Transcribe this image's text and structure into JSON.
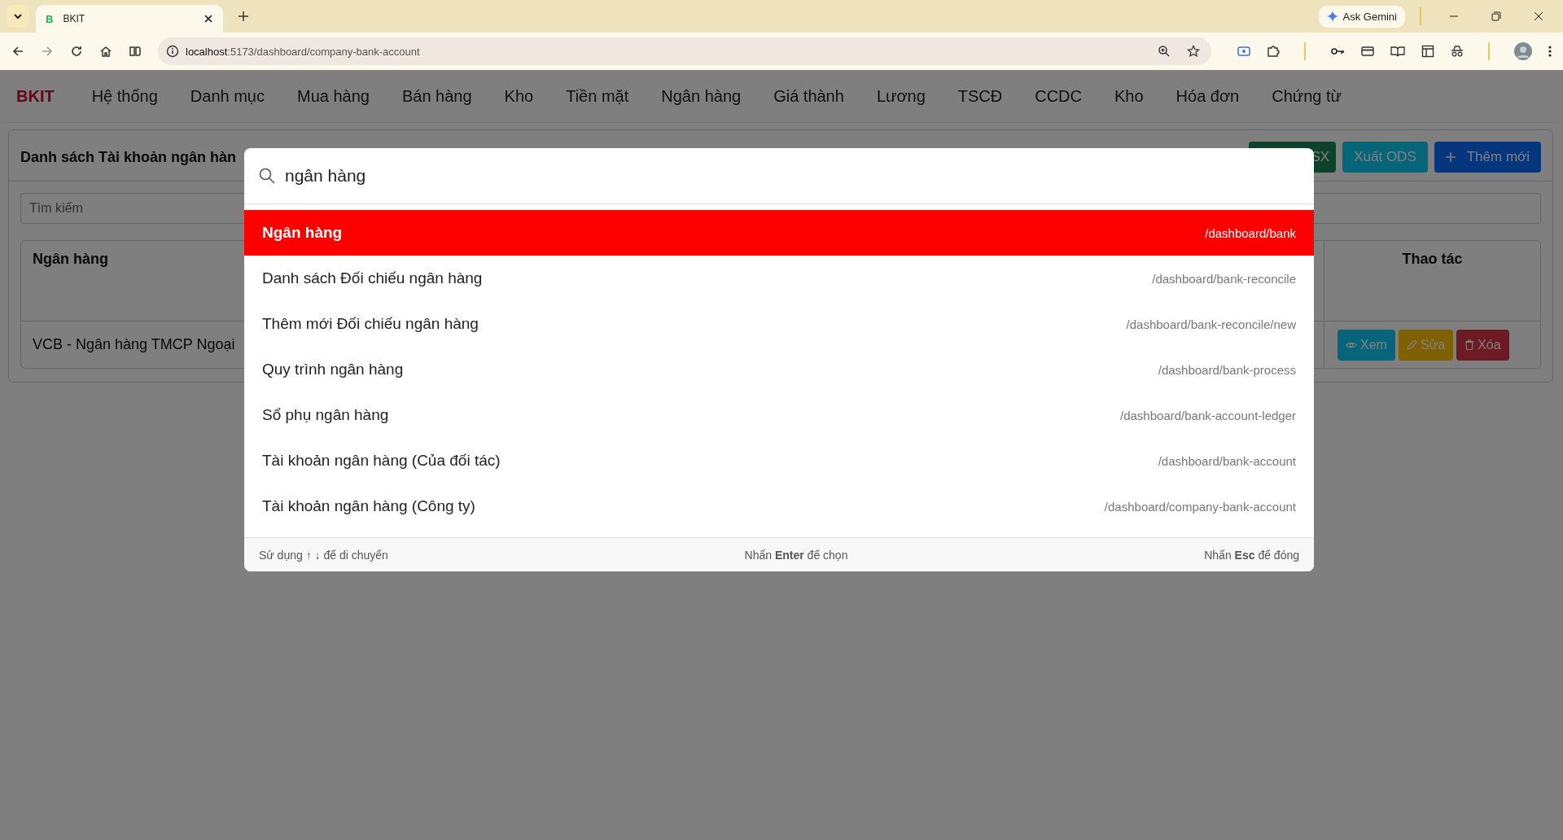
{
  "browser": {
    "tab_title": "BKIT",
    "tab_favicon": "B",
    "url_host": "localhost",
    "url_path": ":5173/dashboard/company-bank-account",
    "gemini_label": "Ask Gemini"
  },
  "nav": {
    "brand": "BKIT",
    "items": [
      "Hệ thống",
      "Danh mục",
      "Mua hàng",
      "Bán hàng",
      "Kho",
      "Tiền mặt",
      "Ngân hàng",
      "Giá thành",
      "Lương",
      "TSCĐ",
      "CCDC",
      "Kho",
      "Hóa đơn",
      "Chứng từ"
    ]
  },
  "page": {
    "title": "Danh sách Tài khoản ngân hàn",
    "buttons": [
      {
        "label": "SX",
        "kind": "xlsx"
      },
      {
        "label": "Xuất ODS",
        "kind": "ods"
      },
      {
        "label": "Thêm mới",
        "kind": "add"
      }
    ],
    "search_placeholder": "Tìm kiếm",
    "table": {
      "columns": [
        "Ngân hàng",
        "Thao tác"
      ],
      "rows": [
        {
          "bank": "VCB - Ngân hàng TMCP Ngoại",
          "actions": [
            {
              "label": "Xem",
              "kind": "view"
            },
            {
              "label": "Sửa",
              "kind": "edit"
            },
            {
              "label": "Xóa",
              "kind": "delete"
            }
          ]
        }
      ]
    }
  },
  "palette": {
    "query": "ngân hàng",
    "results": [
      {
        "title": "Ngân hàng",
        "path": "/dashboard/bank",
        "selected": true
      },
      {
        "title": "Danh sách Đối chiếu ngân hàng",
        "path": "/dashboard/bank-reconcile",
        "selected": false
      },
      {
        "title": "Thêm mới Đối chiếu ngân hàng",
        "path": "/dashboard/bank-reconcile/new",
        "selected": false
      },
      {
        "title": "Quy trình ngân hàng",
        "path": "/dashboard/bank-process",
        "selected": false
      },
      {
        "title": "Sổ phụ ngân hàng",
        "path": "/dashboard/bank-account-ledger",
        "selected": false
      },
      {
        "title": "Tài khoản ngân hàng (Của đối tác)",
        "path": "/dashboard/bank-account",
        "selected": false
      },
      {
        "title": "Tài khoản ngân hàng (Công ty)",
        "path": "/dashboard/company-bank-account",
        "selected": false
      }
    ],
    "hints": [
      "Sử dụng ↑ ↓ để di chuyển",
      "Nhấn **Enter** để chọn",
      "Nhấn **Esc** để đóng"
    ]
  }
}
